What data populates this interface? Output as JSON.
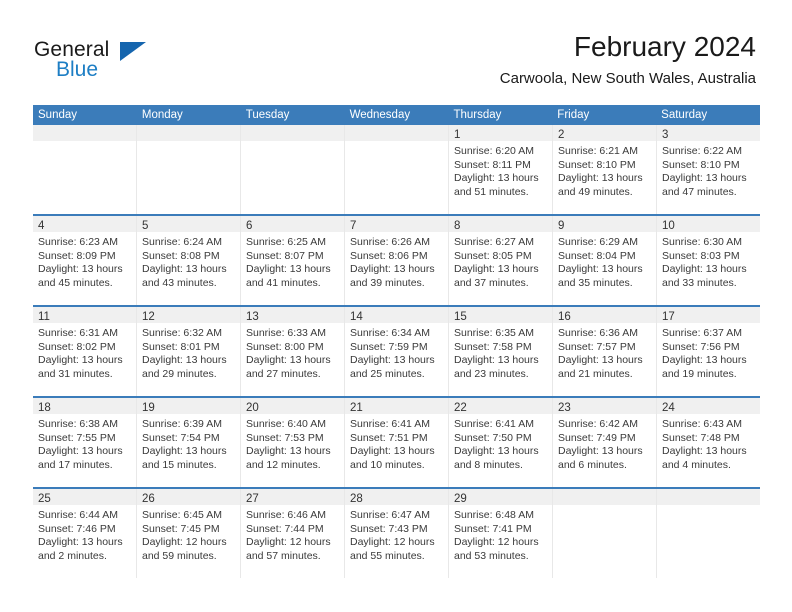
{
  "brand": {
    "name_part1": "General",
    "name_part2": "Blue",
    "triangle_icon": "triangle-icon",
    "accent_blue": "#1d7ec4",
    "triangle_blue": "#1565ae"
  },
  "header": {
    "month_title": "February 2024",
    "location": "Carwoola, New South Wales, Australia"
  },
  "calendar": {
    "header_color": "#3b7cba",
    "day_band_color": "#f0f0f0",
    "weekdays": [
      "Sunday",
      "Monday",
      "Tuesday",
      "Wednesday",
      "Thursday",
      "Friday",
      "Saturday"
    ],
    "weeks": [
      [
        {
          "empty": true
        },
        {
          "empty": true
        },
        {
          "empty": true
        },
        {
          "empty": true
        },
        {
          "day": "1",
          "sunrise": "Sunrise: 6:20 AM",
          "sunset": "Sunset: 8:11 PM",
          "daylight_line1": "Daylight: 13 hours",
          "daylight_line2": "and 51 minutes."
        },
        {
          "day": "2",
          "sunrise": "Sunrise: 6:21 AM",
          "sunset": "Sunset: 8:10 PM",
          "daylight_line1": "Daylight: 13 hours",
          "daylight_line2": "and 49 minutes."
        },
        {
          "day": "3",
          "sunrise": "Sunrise: 6:22 AM",
          "sunset": "Sunset: 8:10 PM",
          "daylight_line1": "Daylight: 13 hours",
          "daylight_line2": "and 47 minutes."
        }
      ],
      [
        {
          "day": "4",
          "sunrise": "Sunrise: 6:23 AM",
          "sunset": "Sunset: 8:09 PM",
          "daylight_line1": "Daylight: 13 hours",
          "daylight_line2": "and 45 minutes."
        },
        {
          "day": "5",
          "sunrise": "Sunrise: 6:24 AM",
          "sunset": "Sunset: 8:08 PM",
          "daylight_line1": "Daylight: 13 hours",
          "daylight_line2": "and 43 minutes."
        },
        {
          "day": "6",
          "sunrise": "Sunrise: 6:25 AM",
          "sunset": "Sunset: 8:07 PM",
          "daylight_line1": "Daylight: 13 hours",
          "daylight_line2": "and 41 minutes."
        },
        {
          "day": "7",
          "sunrise": "Sunrise: 6:26 AM",
          "sunset": "Sunset: 8:06 PM",
          "daylight_line1": "Daylight: 13 hours",
          "daylight_line2": "and 39 minutes."
        },
        {
          "day": "8",
          "sunrise": "Sunrise: 6:27 AM",
          "sunset": "Sunset: 8:05 PM",
          "daylight_line1": "Daylight: 13 hours",
          "daylight_line2": "and 37 minutes."
        },
        {
          "day": "9",
          "sunrise": "Sunrise: 6:29 AM",
          "sunset": "Sunset: 8:04 PM",
          "daylight_line1": "Daylight: 13 hours",
          "daylight_line2": "and 35 minutes."
        },
        {
          "day": "10",
          "sunrise": "Sunrise: 6:30 AM",
          "sunset": "Sunset: 8:03 PM",
          "daylight_line1": "Daylight: 13 hours",
          "daylight_line2": "and 33 minutes."
        }
      ],
      [
        {
          "day": "11",
          "sunrise": "Sunrise: 6:31 AM",
          "sunset": "Sunset: 8:02 PM",
          "daylight_line1": "Daylight: 13 hours",
          "daylight_line2": "and 31 minutes."
        },
        {
          "day": "12",
          "sunrise": "Sunrise: 6:32 AM",
          "sunset": "Sunset: 8:01 PM",
          "daylight_line1": "Daylight: 13 hours",
          "daylight_line2": "and 29 minutes."
        },
        {
          "day": "13",
          "sunrise": "Sunrise: 6:33 AM",
          "sunset": "Sunset: 8:00 PM",
          "daylight_line1": "Daylight: 13 hours",
          "daylight_line2": "and 27 minutes."
        },
        {
          "day": "14",
          "sunrise": "Sunrise: 6:34 AM",
          "sunset": "Sunset: 7:59 PM",
          "daylight_line1": "Daylight: 13 hours",
          "daylight_line2": "and 25 minutes."
        },
        {
          "day": "15",
          "sunrise": "Sunrise: 6:35 AM",
          "sunset": "Sunset: 7:58 PM",
          "daylight_line1": "Daylight: 13 hours",
          "daylight_line2": "and 23 minutes."
        },
        {
          "day": "16",
          "sunrise": "Sunrise: 6:36 AM",
          "sunset": "Sunset: 7:57 PM",
          "daylight_line1": "Daylight: 13 hours",
          "daylight_line2": "and 21 minutes."
        },
        {
          "day": "17",
          "sunrise": "Sunrise: 6:37 AM",
          "sunset": "Sunset: 7:56 PM",
          "daylight_line1": "Daylight: 13 hours",
          "daylight_line2": "and 19 minutes."
        }
      ],
      [
        {
          "day": "18",
          "sunrise": "Sunrise: 6:38 AM",
          "sunset": "Sunset: 7:55 PM",
          "daylight_line1": "Daylight: 13 hours",
          "daylight_line2": "and 17 minutes."
        },
        {
          "day": "19",
          "sunrise": "Sunrise: 6:39 AM",
          "sunset": "Sunset: 7:54 PM",
          "daylight_line1": "Daylight: 13 hours",
          "daylight_line2": "and 15 minutes."
        },
        {
          "day": "20",
          "sunrise": "Sunrise: 6:40 AM",
          "sunset": "Sunset: 7:53 PM",
          "daylight_line1": "Daylight: 13 hours",
          "daylight_line2": "and 12 minutes."
        },
        {
          "day": "21",
          "sunrise": "Sunrise: 6:41 AM",
          "sunset": "Sunset: 7:51 PM",
          "daylight_line1": "Daylight: 13 hours",
          "daylight_line2": "and 10 minutes."
        },
        {
          "day": "22",
          "sunrise": "Sunrise: 6:41 AM",
          "sunset": "Sunset: 7:50 PM",
          "daylight_line1": "Daylight: 13 hours",
          "daylight_line2": "and 8 minutes."
        },
        {
          "day": "23",
          "sunrise": "Sunrise: 6:42 AM",
          "sunset": "Sunset: 7:49 PM",
          "daylight_line1": "Daylight: 13 hours",
          "daylight_line2": "and 6 minutes."
        },
        {
          "day": "24",
          "sunrise": "Sunrise: 6:43 AM",
          "sunset": "Sunset: 7:48 PM",
          "daylight_line1": "Daylight: 13 hours",
          "daylight_line2": "and 4 minutes."
        }
      ],
      [
        {
          "day": "25",
          "sunrise": "Sunrise: 6:44 AM",
          "sunset": "Sunset: 7:46 PM",
          "daylight_line1": "Daylight: 13 hours",
          "daylight_line2": "and 2 minutes."
        },
        {
          "day": "26",
          "sunrise": "Sunrise: 6:45 AM",
          "sunset": "Sunset: 7:45 PM",
          "daylight_line1": "Daylight: 12 hours",
          "daylight_line2": "and 59 minutes."
        },
        {
          "day": "27",
          "sunrise": "Sunrise: 6:46 AM",
          "sunset": "Sunset: 7:44 PM",
          "daylight_line1": "Daylight: 12 hours",
          "daylight_line2": "and 57 minutes."
        },
        {
          "day": "28",
          "sunrise": "Sunrise: 6:47 AM",
          "sunset": "Sunset: 7:43 PM",
          "daylight_line1": "Daylight: 12 hours",
          "daylight_line2": "and 55 minutes."
        },
        {
          "day": "29",
          "sunrise": "Sunrise: 6:48 AM",
          "sunset": "Sunset: 7:41 PM",
          "daylight_line1": "Daylight: 12 hours",
          "daylight_line2": "and 53 minutes."
        },
        {
          "empty": true
        },
        {
          "empty": true
        }
      ]
    ]
  }
}
